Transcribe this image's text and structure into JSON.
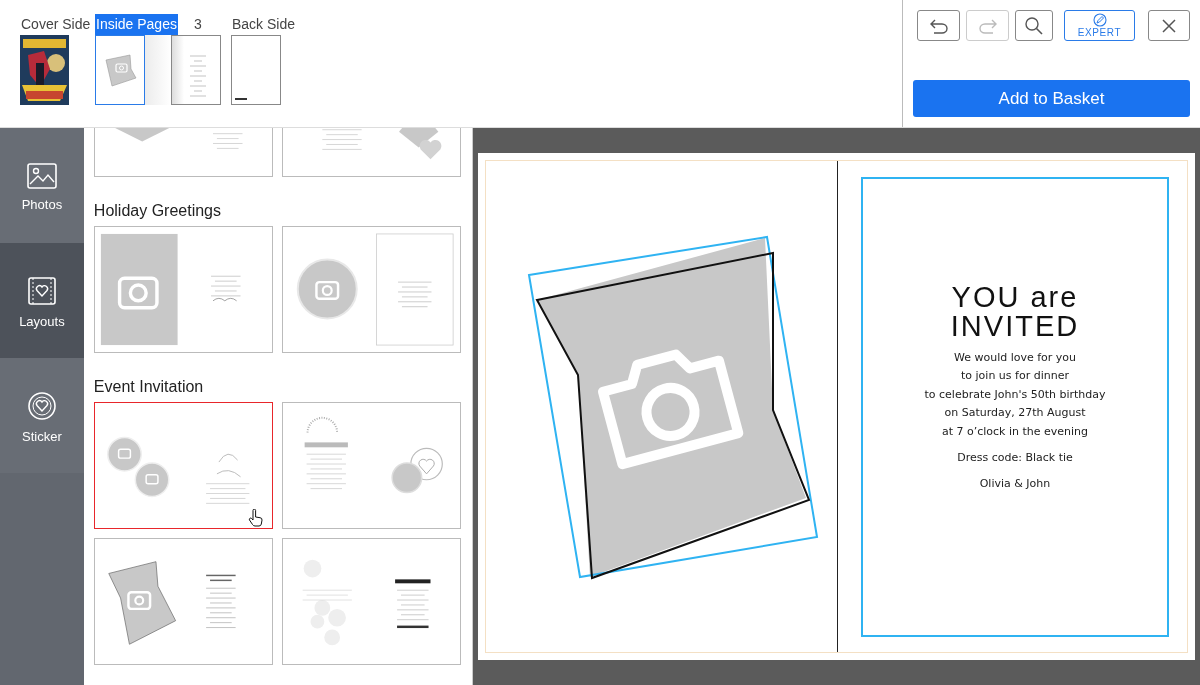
{
  "page_tabs": [
    {
      "label": "Cover Side",
      "selected": false,
      "kind": "cover"
    },
    {
      "label": "Inside Pages",
      "selected": true,
      "kind": "photo_page"
    },
    {
      "label": "3",
      "selected": false,
      "kind": "text_page"
    },
    {
      "label": "Back Side",
      "selected": false,
      "kind": "blank"
    }
  ],
  "toolbar": [
    {
      "kind": "undo",
      "disabled": false
    },
    {
      "kind": "redo",
      "disabled": true
    },
    {
      "kind": "search",
      "disabled": false
    },
    {
      "kind": "expert",
      "label": "EXPERT",
      "disabled": false
    },
    {
      "kind": "close",
      "disabled": false
    }
  ],
  "basket_button": "Add to Basket",
  "sidebar": [
    {
      "label": "Photos",
      "kind": "photos",
      "selected": false
    },
    {
      "label": "Layouts",
      "kind": "layouts",
      "selected": true
    },
    {
      "label": "Sticker",
      "kind": "sticker",
      "selected": false
    }
  ],
  "sections": [
    {
      "templates": [
        {
          "kind": "heart",
          "selected": false
        },
        {
          "kind": "hearts",
          "selected": false
        }
      ]
    },
    {
      "title": "Holiday Greetings",
      "templates": [
        {
          "kind": "holiday_rect",
          "selected": false
        },
        {
          "kind": "holiday_circle",
          "selected": false
        }
      ]
    },
    {
      "title": "Event Invitation",
      "templates": [
        {
          "kind": "two_circles",
          "selected": true
        },
        {
          "kind": "invited_hearts",
          "selected": false
        },
        {
          "kind": "tilted",
          "selected": false
        },
        {
          "kind": "grapes",
          "selected": false
        }
      ]
    }
  ],
  "invitation": {
    "heading": [
      "YOU are",
      "INVITED"
    ],
    "lines": [
      "We would love for you",
      "to join us for dinner",
      "to celebrate John's 50th birthday",
      "on Saturday, 27th August",
      "at 7 o’clock in the evening"
    ],
    "dress_code": "Dress code: Black tie",
    "signature": "Olivia & John"
  }
}
